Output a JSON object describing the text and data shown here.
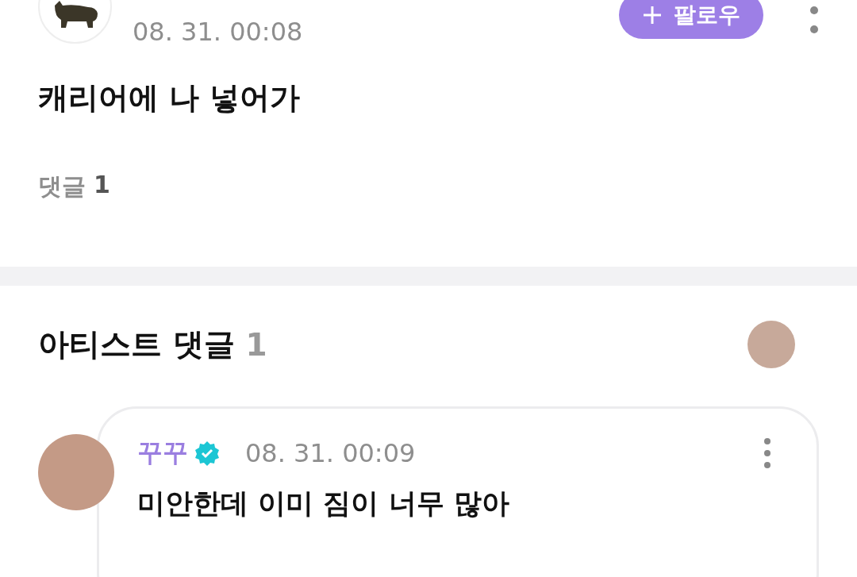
{
  "post": {
    "time": "08. 31. 00:08",
    "follow_label": "팔로우",
    "text": "캐리어에 나 넣어가",
    "comments_label": "댓글",
    "comments_count": "1"
  },
  "artist_comments": {
    "title": "아티스트 댓글",
    "count": "1",
    "comments": [
      {
        "author": "꾸꾸",
        "verified": true,
        "time": "08. 31. 00:09",
        "text": "미안한데 이미 짐이 너무 많아"
      }
    ]
  }
}
